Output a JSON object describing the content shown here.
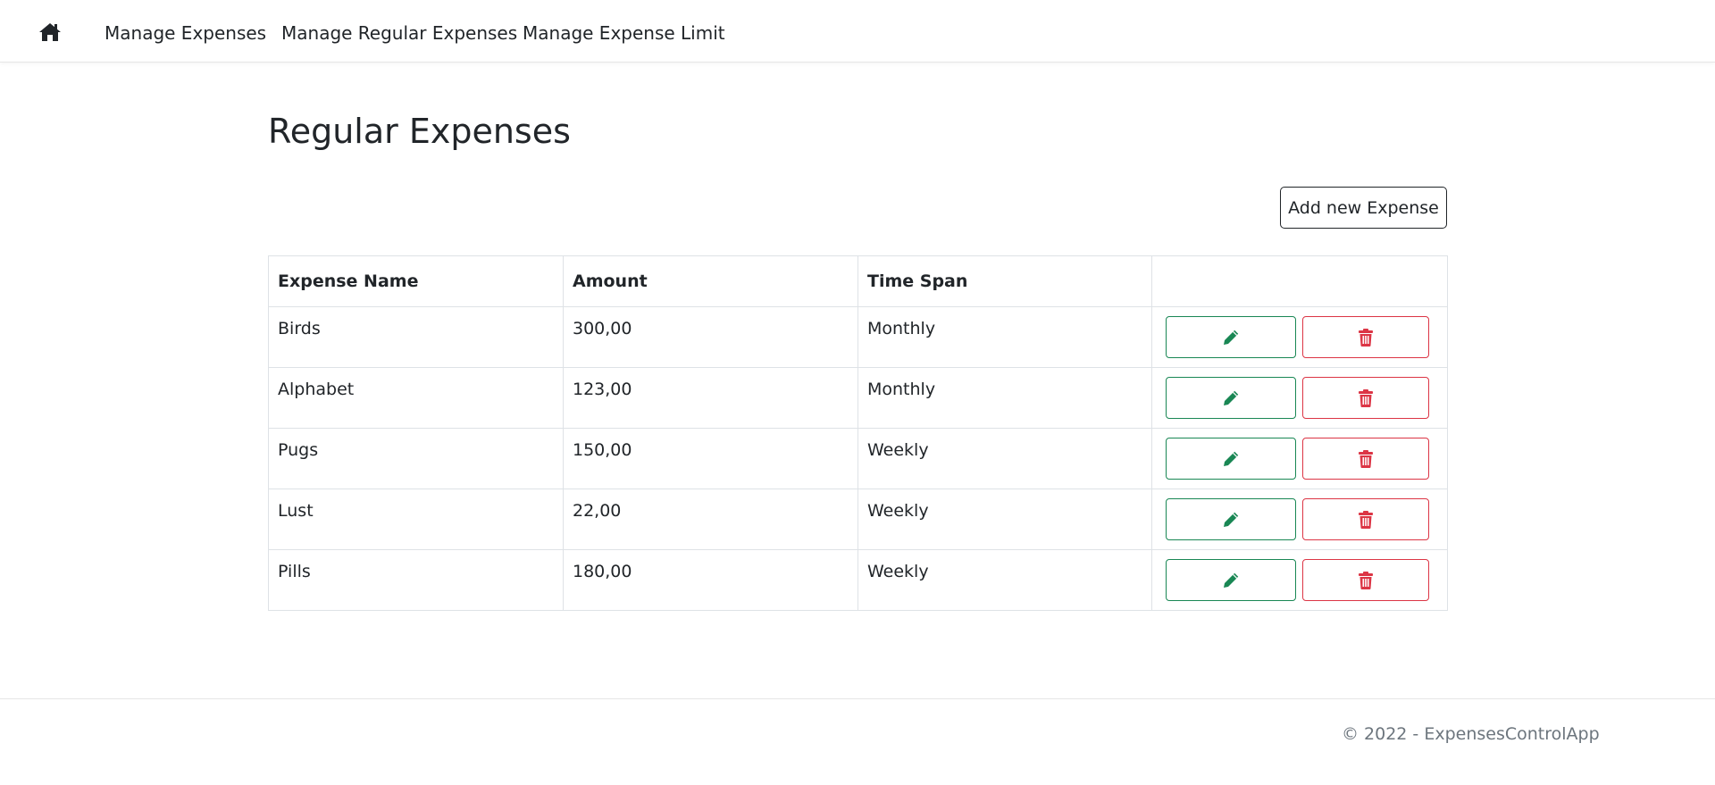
{
  "nav": {
    "home_icon": "home-icon",
    "links": [
      {
        "label": "Manage Expenses"
      },
      {
        "label": "Manage Regular Expenses"
      },
      {
        "label": "Manage Expense Limit"
      }
    ]
  },
  "main": {
    "title": "Regular Expenses",
    "add_button_label": "Add new Expense",
    "table": {
      "headers": [
        "Expense Name",
        "Amount",
        "Time Span",
        ""
      ],
      "rows": [
        {
          "name": "Birds",
          "amount": "300,00",
          "time_span": "Monthly"
        },
        {
          "name": "Alphabet",
          "amount": "123,00",
          "time_span": "Monthly"
        },
        {
          "name": "Pugs",
          "amount": "150,00",
          "time_span": "Weekly"
        },
        {
          "name": "Lust",
          "amount": "22,00",
          "time_span": "Weekly"
        },
        {
          "name": "Pills",
          "amount": "180,00",
          "time_span": "Weekly"
        }
      ],
      "edit_icon": "pencil-icon",
      "delete_icon": "trash-icon"
    }
  },
  "footer": {
    "text": "© 2022 - ExpensesControlApp"
  },
  "colors": {
    "edit": "#198754",
    "delete": "#dc3545",
    "text": "#212529",
    "muted": "#6c757d"
  }
}
